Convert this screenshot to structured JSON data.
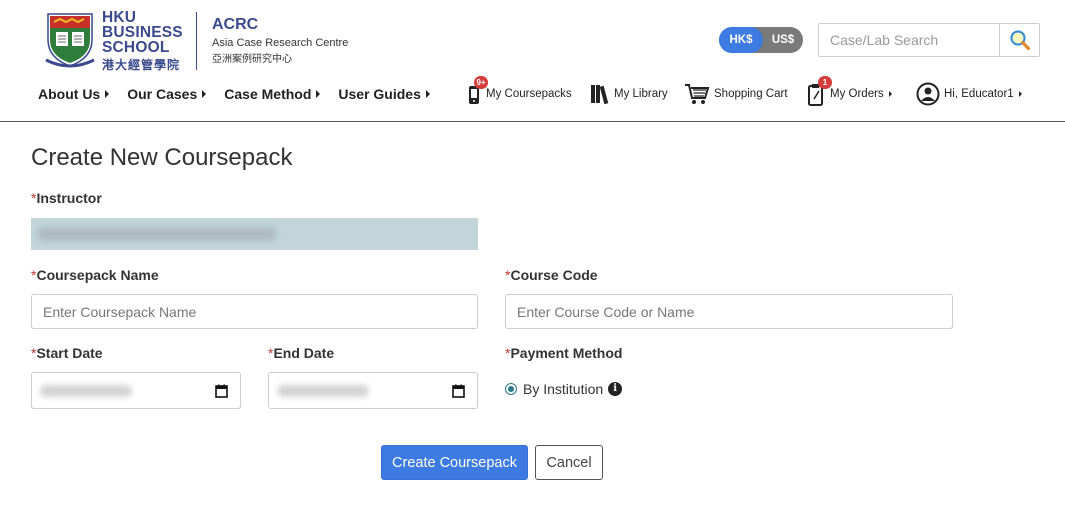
{
  "logo": {
    "hku_line1": "HKU",
    "hku_line2": "BUSINESS",
    "hku_line3": "SCHOOL",
    "hku_cn": "港大經管學院",
    "acrc_title": "ACRC",
    "acrc_subtitle": "Asia Case Research Centre",
    "acrc_cn": "亞洲案例研究中心"
  },
  "currency": {
    "options": [
      "HK$",
      "US$"
    ],
    "selected": "HK$"
  },
  "search": {
    "placeholder": "Case/Lab Search"
  },
  "main_nav": {
    "items": [
      {
        "label": "About Us"
      },
      {
        "label": "Our Cases"
      },
      {
        "label": "Case Method"
      },
      {
        "label": "User Guides"
      }
    ]
  },
  "util_nav": {
    "coursepacks": {
      "label": "My Coursepacks",
      "badge": "9+"
    },
    "library": {
      "label": "My Library"
    },
    "cart": {
      "label": "Shopping Cart"
    },
    "orders": {
      "label": "My Orders",
      "badge": "1"
    },
    "account": {
      "label": "Hi, Educator1"
    }
  },
  "form": {
    "title": "Create New Coursepack",
    "required_mark": "*",
    "instructor_label": "Instructor",
    "coursepack_name_label": "Coursepack Name",
    "coursepack_name_placeholder": "Enter Coursepack Name",
    "course_code_label": "Course Code",
    "course_code_placeholder": "Enter Course Code or Name",
    "start_date_label": "Start Date",
    "end_date_label": "End Date",
    "payment_method_label": "Payment Method",
    "payment_option": "By Institution",
    "info_glyph": "i",
    "submit_label": "Create Coursepack",
    "cancel_label": "Cancel"
  },
  "colors": {
    "brand_navy": "#3a4a8c",
    "primary_blue": "#3d7be2",
    "required_red": "#c0392b",
    "badge_red": "#d63b3b",
    "readonly_bg": "#c2d5d9"
  },
  "icons": {
    "search": "magnifier-icon",
    "coursepacks": "phone-icon",
    "library": "books-icon",
    "cart": "cart-icon",
    "orders": "clipboard-icon",
    "account": "user-circle-icon",
    "calendar": "calendar-icon",
    "info": "info-icon"
  }
}
